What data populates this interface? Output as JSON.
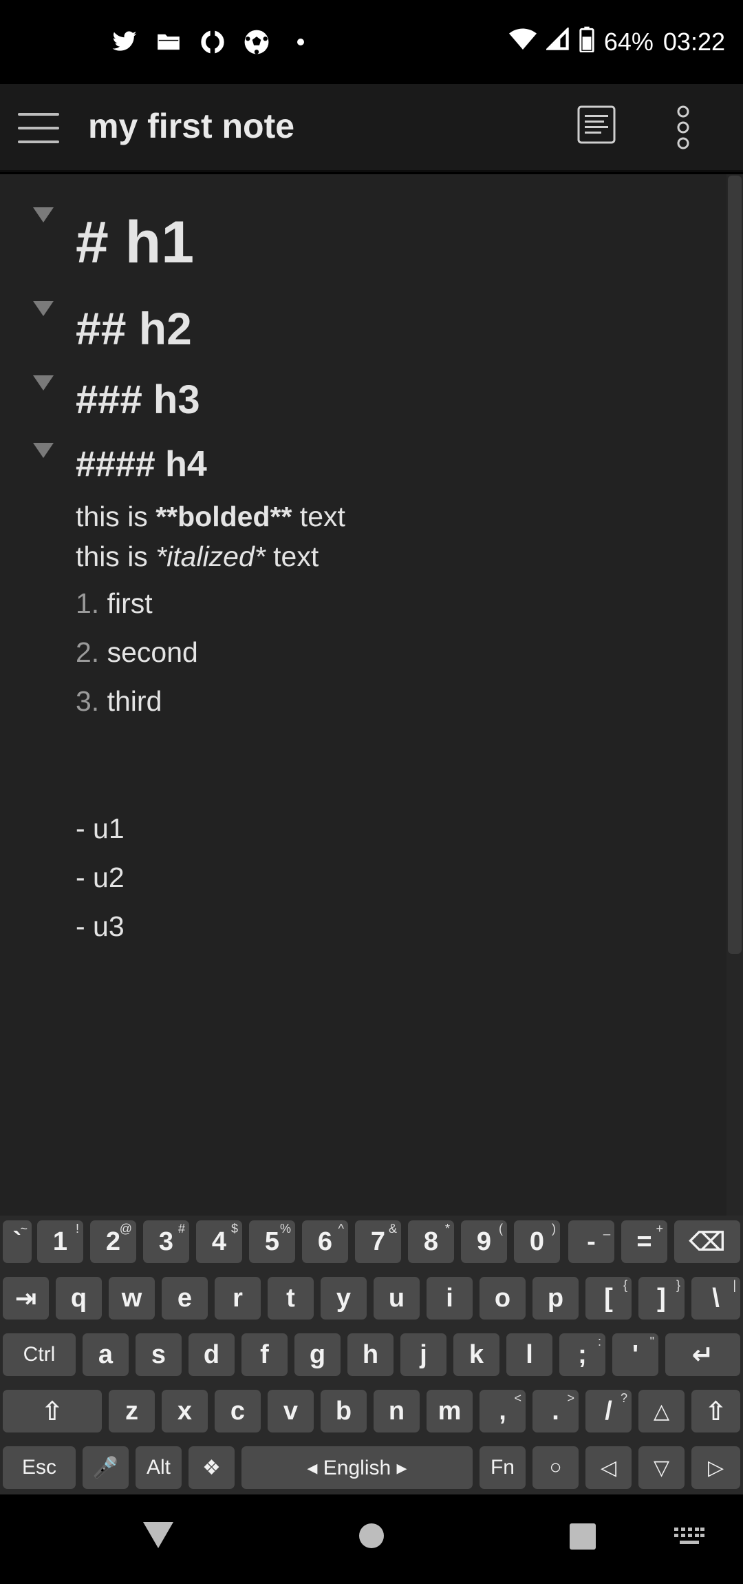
{
  "status_bar": {
    "icons": [
      "twitter-icon",
      "folder-icon",
      "sync-icon",
      "soccer-ball-icon",
      "dot-icon"
    ],
    "battery": "64%",
    "time": "03:22"
  },
  "app_bar": {
    "title": "my first note",
    "preview_icon": "document-preview-icon",
    "more_icon": "more-vertical-icon"
  },
  "editor": {
    "h1": "# h1",
    "h2": "## h2",
    "h3": "### h3",
    "h4": "#### h4",
    "bold_line": {
      "prefix": "this is ",
      "marked": "**bolded**",
      "suffix": " text"
    },
    "italic_line": {
      "prefix": "this is ",
      "marked": "*italized*",
      "suffix": " text"
    },
    "ordered": [
      {
        "num": "1.",
        "text": "first"
      },
      {
        "num": "2.",
        "text": "second"
      },
      {
        "num": "3.",
        "text": "third"
      }
    ],
    "unordered": [
      "- u1",
      "- u2",
      "- u3"
    ]
  },
  "keyboard": {
    "row1": [
      {
        "label": "`",
        "sup": "~"
      },
      {
        "label": "1",
        "sup": "!"
      },
      {
        "label": "2",
        "sup": "@"
      },
      {
        "label": "3",
        "sup": "#"
      },
      {
        "label": "4",
        "sup": "$"
      },
      {
        "label": "5",
        "sup": "%"
      },
      {
        "label": "6",
        "sup": "^"
      },
      {
        "label": "7",
        "sup": "&"
      },
      {
        "label": "8",
        "sup": "*"
      },
      {
        "label": "9",
        "sup": "("
      },
      {
        "label": "0",
        "sup": ")"
      },
      {
        "label": "-",
        "sup": "_"
      },
      {
        "label": "=",
        "sup": "+"
      },
      {
        "label": "⌫",
        "sup": ""
      }
    ],
    "row2": [
      {
        "label": "⇥",
        "sup": ""
      },
      {
        "label": "q",
        "sup": ""
      },
      {
        "label": "w",
        "sup": ""
      },
      {
        "label": "e",
        "sup": ""
      },
      {
        "label": "r",
        "sup": ""
      },
      {
        "label": "t",
        "sup": ""
      },
      {
        "label": "y",
        "sup": ""
      },
      {
        "label": "u",
        "sup": ""
      },
      {
        "label": "i",
        "sup": ""
      },
      {
        "label": "o",
        "sup": ""
      },
      {
        "label": "p",
        "sup": ""
      },
      {
        "label": "[",
        "sup": "{"
      },
      {
        "label": "]",
        "sup": "}"
      },
      {
        "label": "\\",
        "sup": "|"
      }
    ],
    "row3": [
      {
        "label": "Ctrl",
        "sup": ""
      },
      {
        "label": "a",
        "sup": ""
      },
      {
        "label": "s",
        "sup": ""
      },
      {
        "label": "d",
        "sup": ""
      },
      {
        "label": "f",
        "sup": ""
      },
      {
        "label": "g",
        "sup": ""
      },
      {
        "label": "h",
        "sup": ""
      },
      {
        "label": "j",
        "sup": ""
      },
      {
        "label": "k",
        "sup": ""
      },
      {
        "label": "l",
        "sup": ""
      },
      {
        "label": ";",
        "sup": ":"
      },
      {
        "label": "'",
        "sup": "\""
      },
      {
        "label": "↵",
        "sup": ""
      }
    ],
    "row4": [
      {
        "label": "⇧",
        "sup": ""
      },
      {
        "label": "z",
        "sup": ""
      },
      {
        "label": "x",
        "sup": ""
      },
      {
        "label": "c",
        "sup": ""
      },
      {
        "label": "v",
        "sup": ""
      },
      {
        "label": "b",
        "sup": ""
      },
      {
        "label": "n",
        "sup": ""
      },
      {
        "label": "m",
        "sup": ""
      },
      {
        "label": ",",
        "sup": "<"
      },
      {
        "label": ".",
        "sup": ">"
      },
      {
        "label": "/",
        "sup": "?"
      },
      {
        "label": "△",
        "sup": ""
      },
      {
        "label": "⇧",
        "sup": ""
      }
    ],
    "row5": [
      {
        "label": "Esc",
        "sup": ""
      },
      {
        "label": "🎤",
        "sup": ""
      },
      {
        "label": "Alt",
        "sup": ""
      },
      {
        "label": "❖",
        "sup": ""
      },
      {
        "label": "◂ English ▸",
        "sup": ""
      },
      {
        "label": "Fn",
        "sup": ""
      },
      {
        "label": "○",
        "sup": ""
      },
      {
        "label": "◁",
        "sup": ""
      },
      {
        "label": "▽",
        "sup": ""
      },
      {
        "label": "▷",
        "sup": ""
      }
    ]
  },
  "nav_bar": {
    "back_icon": "back-triangle-icon",
    "home_icon": "home-circle-icon",
    "recents_icon": "recents-square-icon",
    "keyboard_icon": "keyboard-icon"
  }
}
